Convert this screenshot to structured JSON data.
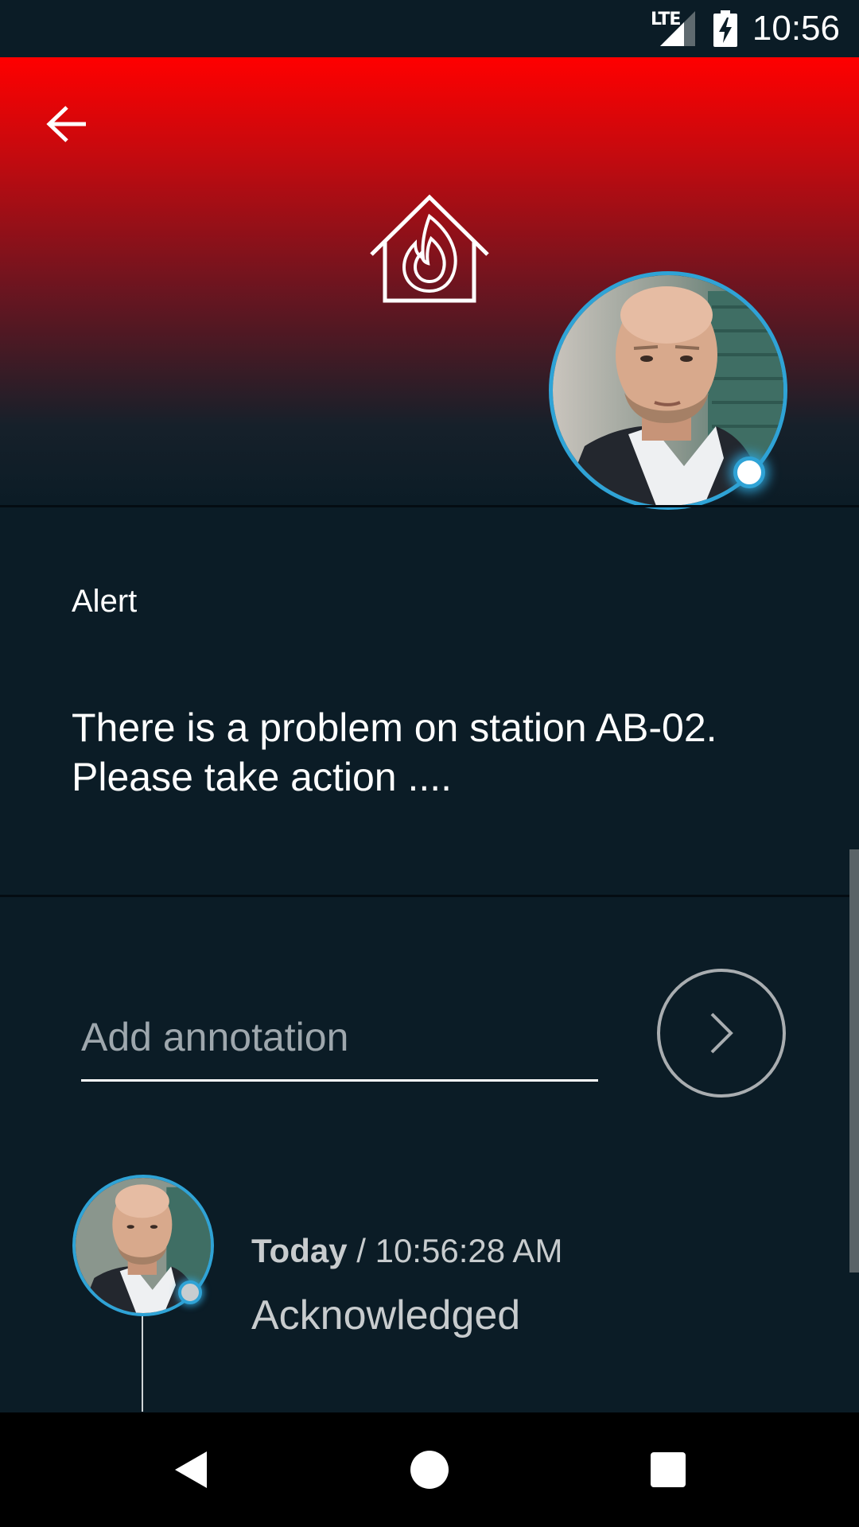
{
  "status_bar": {
    "network": "LTE",
    "time": "10:56"
  },
  "header": {
    "accent_color": "#ff0000",
    "avatar_ring_color": "#2fa3d6",
    "alert_icon": "house-fire-icon"
  },
  "alert": {
    "label": "Alert",
    "message": "There is a problem on station AB-02. Please take action ...."
  },
  "annotation": {
    "placeholder": "Add annotation",
    "value": ""
  },
  "timeline": {
    "items": [
      {
        "day": "Today",
        "separator": " / ",
        "time": "10:56:28 AM",
        "status": "Acknowledged"
      }
    ]
  },
  "icons": {
    "back": "arrow-back-icon",
    "send": "chevron-right-icon",
    "nav_back": "nav-back-icon",
    "nav_home": "nav-home-icon",
    "nav_recents": "nav-recents-icon"
  }
}
